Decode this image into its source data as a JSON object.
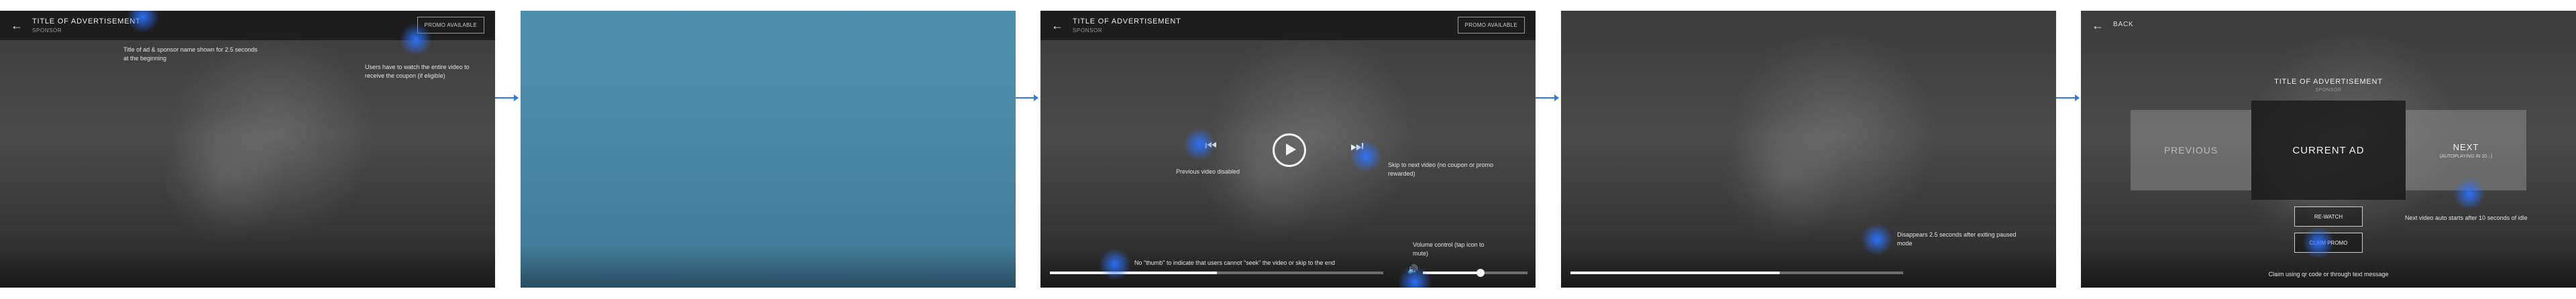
{
  "colors": {
    "accent_blue": "#2f7bd6",
    "overlay_blue": "#4a87a5",
    "dark_bar": "#141414"
  },
  "header": {
    "back_icon": "back-arrow-icon",
    "title": "TITLE OF ADVERTISEMENT",
    "sponsor": "SPONSOR",
    "promo": "PROMO AVAILABLE"
  },
  "screen1": {
    "note_sponsor": "Title of ad & sponsor name shown for 2.5 seconds at the beginning",
    "note_watch": "Users have to watch the entire video to receive the coupon (if eligible)"
  },
  "screen3": {
    "prev_icon": "skip-previous-icon",
    "play_icon": "play-icon",
    "next_icon": "skip-next-icon",
    "volume_icon": "volume-icon",
    "note_prev": "Previous video disabled",
    "note_skip": "Skip to next video (no coupon or promo rewarded)",
    "note_volume": "Volume control (tap icon to mute)",
    "note_thumb": "No \"thumb\" to indicate that users cannot \"seek\" the video or skip to the end",
    "progress": 0.5,
    "volume": 0.55
  },
  "screen4": {
    "note_disappear": "Disappears 2.5 seconds after exiting paused mode",
    "progress": 0.63
  },
  "screen5": {
    "back_label": "BACK",
    "title": "TITLE OF ADVERTISEMENT",
    "sponsor": "SPONSOR",
    "previous_label": "PREVIOUS",
    "current_label": "CURRENT AD",
    "next_label": "NEXT",
    "next_sub": "(AUTOPLAYING IN 10...)",
    "rewatch_label": "RE-WATCH",
    "claim_label": "CLAIM PROMO",
    "note_autostart": "Next video auto starts after 10 seconds of idle",
    "note_claim": "Claim using qr code or through text message"
  }
}
